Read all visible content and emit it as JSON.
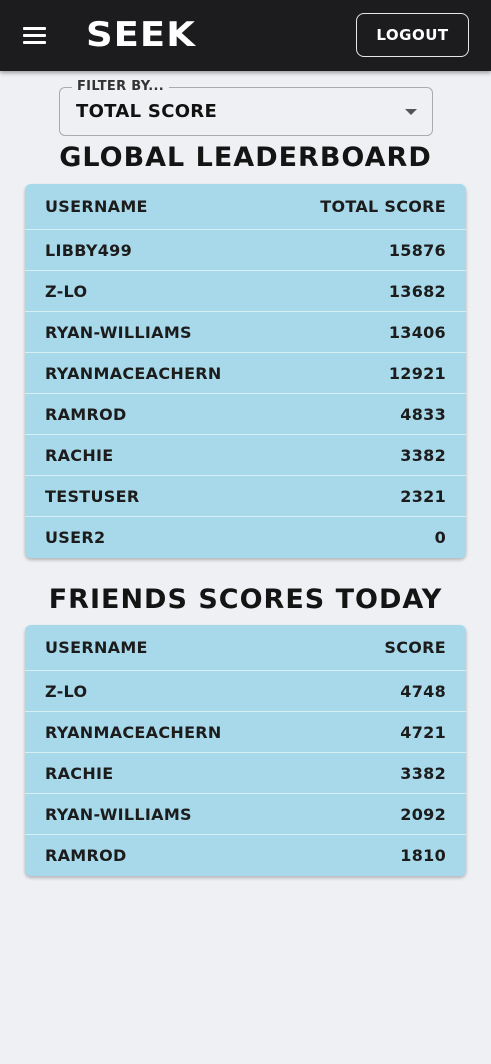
{
  "app": {
    "logo": "SEEK",
    "logout_label": "Logout"
  },
  "filter": {
    "label": "Filter by...",
    "value": "Total Score"
  },
  "global": {
    "title": "Global Leaderboard",
    "col_user": "Username",
    "col_score": "Total Score",
    "rows": [
      {
        "user": "libby499",
        "score": "15876"
      },
      {
        "user": "z-lo",
        "score": "13682"
      },
      {
        "user": "ryan-williams",
        "score": "13406"
      },
      {
        "user": "ryanmaceachern",
        "score": "12921"
      },
      {
        "user": "ramrod",
        "score": "4833"
      },
      {
        "user": "rachie",
        "score": "3382"
      },
      {
        "user": "testuser",
        "score": "2321"
      },
      {
        "user": "user2",
        "score": "0"
      }
    ]
  },
  "friends": {
    "title": "Friends Scores Today",
    "col_user": "Username",
    "col_score": "Score",
    "rows": [
      {
        "user": "z-lo",
        "score": "4748"
      },
      {
        "user": "ryanmaceachern",
        "score": "4721"
      },
      {
        "user": "rachie",
        "score": "3382"
      },
      {
        "user": "ryan-williams",
        "score": "2092"
      },
      {
        "user": "ramrod",
        "score": "1810"
      }
    ]
  },
  "colors": {
    "topbar": "#1c1c1e",
    "background": "#eef0f4",
    "table_bg": "#a8d9ea"
  },
  "icons": {
    "menu": "hamburger-menu-icon",
    "dropdown": "caret-down-icon"
  }
}
